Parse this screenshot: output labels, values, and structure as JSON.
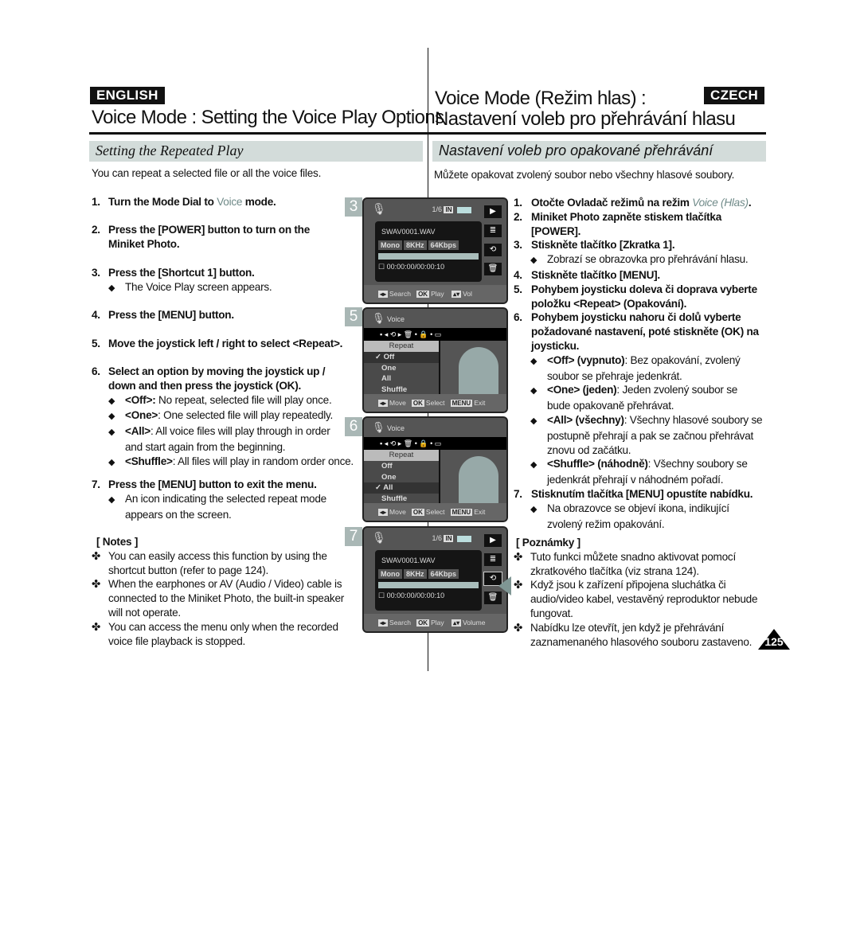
{
  "header": {
    "english_badge": "ENGLISH",
    "czech_badge": "CZECH",
    "title_en": "Voice Mode : Setting the Voice Play Options",
    "title_cz_1": "Voice Mode (Režim hlas) :",
    "title_cz_2": "Nastavení voleb pro přehrávání hlasu"
  },
  "section": {
    "en": "Setting the Repeated Play",
    "cz": "Nastavení voleb pro opakované přehrávání"
  },
  "intro": {
    "en": "You can repeat a selected file or all the voice files.",
    "cz": "Můžete opakovat zvolený soubor nebo všechny hlasové soubory."
  },
  "en_steps": [
    {
      "n": "1.",
      "pre": "Turn the Mode Dial to ",
      "voice": "Voice",
      "post": " mode."
    },
    {
      "n": "2.",
      "text": "Press the [POWER] button to turn on the Miniket Photo."
    },
    {
      "n": "3.",
      "text": "Press the [Shortcut 1] button.",
      "bullet": "The Voice Play screen appears."
    },
    {
      "n": "4.",
      "text": "Press the [MENU] button."
    },
    {
      "n": "5.",
      "text": "Move the joystick left / right to select <Repeat>."
    },
    {
      "n": "6.",
      "text": "Select an option by moving the joystick up / down and then press the joystick (OK).",
      "bullets": [
        {
          "k": "<Off>:",
          "v": " No repeat, selected file will play once."
        },
        {
          "k": "<One>",
          "v": ": One selected file will play repeatedly."
        },
        {
          "k": "<All>",
          "v": ": All voice files will play through in order and start again from the beginning."
        },
        {
          "k": "<Shuffle>",
          "v": ": All files will play in random order once."
        }
      ]
    },
    {
      "n": "7.",
      "text": "Press the [MENU] button to exit the menu.",
      "bullet": "An icon indicating the selected repeat mode appears on the screen."
    }
  ],
  "en_notes": {
    "title": "[ Notes ]",
    "items": [
      "You can easily access this function by using the shortcut button (refer to page 124).",
      "When the earphones or AV (Audio / Video) cable is connected to the Miniket Photo, the built-in speaker will not operate.",
      "You can access the menu only when the recorded voice file playback is stopped."
    ]
  },
  "cz_steps": [
    {
      "n": "1.",
      "pre": "Otočte Ovladač režimů na režim ",
      "voice": "Voice (Hlas)",
      "post": "."
    },
    {
      "n": "2.",
      "text": "Miniket Photo zapněte stiskem tlačítka [POWER]."
    },
    {
      "n": "3.",
      "text": "Stiskněte tlačítko [Zkratka 1].",
      "bullet": "Zobrazí se obrazovka pro přehrávání hlasu."
    },
    {
      "n": "4.",
      "text": "Stiskněte tlačítko [MENU]."
    },
    {
      "n": "5.",
      "text": "Pohybem joysticku doleva či doprava vyberte položku <Repeat> (Opakování)."
    },
    {
      "n": "6.",
      "text": "Pohybem joysticku nahoru či dolů vyberte požadované nastavení, poté stiskněte (OK) na joysticku.",
      "bullets": [
        {
          "k": "<Off> (vypnuto)",
          "v": ": Bez opakování, zvolený soubor se přehraje jedenkrát."
        },
        {
          "k": "<One> (jeden)",
          "v": ": Jeden zvolený soubor se bude opakovaně přehrávat."
        },
        {
          "k": "<All> (všechny)",
          "v": ": Všechny hlasové soubory se postupně přehrají a pak se začnou přehrávat znovu od začátku."
        },
        {
          "k": "<Shuffle> (náhodně)",
          "v": ": Všechny soubory se jedenkrát přehrají v náhodném pořadí."
        }
      ]
    },
    {
      "n": "7.",
      "text": "Stisknutím tlačítka [MENU] opustíte nabídku.",
      "bullet": "Na obrazovce se objeví ikona, indikující zvolený režim opakování."
    }
  ],
  "cz_notes": {
    "title": "[ Poznámky ]",
    "items": [
      "Tuto funkci můžete snadno aktivovat pomocí zkratkového tlačítka (viz strana 124).",
      "Když jsou k  zařízení připojena sluchátka či audio/video kabel, vestavěný reproduktor nebude fungovat.",
      "Nabídku lze otevřít, jen když je přehrávání zaznamenaného hlasového souboru zastaveno."
    ]
  },
  "screens": {
    "s3": {
      "num": "3",
      "counter": "1/6",
      "mem": "IN",
      "file": "SWAV0001.WAV",
      "info": [
        "Mono",
        "8KHz",
        "64Kbps"
      ],
      "time": "00:00:00/00:00:10",
      "hints": [
        {
          "k": "◂▸",
          "t": "Search"
        },
        {
          "k": "OK",
          "t": "Play"
        },
        {
          "k": "▴▾",
          "t": "Vol"
        }
      ]
    },
    "s5": {
      "num": "5",
      "title": "Voice",
      "menu_title": "Repeat",
      "options": [
        "Off",
        "One",
        "All",
        "Shuffle"
      ],
      "selected": "Off",
      "hints": [
        {
          "k": "◂▸",
          "t": "Move"
        },
        {
          "k": "OK",
          "t": "Select"
        },
        {
          "k": "MENU",
          "t": "Exit"
        }
      ]
    },
    "s6": {
      "num": "6",
      "title": "Voice",
      "menu_title": "Repeat",
      "options": [
        "Off",
        "One",
        "All",
        "Shuffle"
      ],
      "selected": "All",
      "hints": [
        {
          "k": "◂▸",
          "t": "Move"
        },
        {
          "k": "OK",
          "t": "Select"
        },
        {
          "k": "MENU",
          "t": "Exit"
        }
      ]
    },
    "s7": {
      "num": "7",
      "counter": "1/6",
      "mem": "IN",
      "file": "SWAV0001.WAV",
      "info": [
        "Mono",
        "8KHz",
        "64Kbps"
      ],
      "time": "00:00:00/00:00:10",
      "hints": [
        {
          "k": "◂▸",
          "t": "Search"
        },
        {
          "k": "OK",
          "t": "Play"
        },
        {
          "k": "▴▾",
          "t": "Volume"
        }
      ]
    }
  },
  "page_number": "125",
  "colors": {
    "section_bg": "#d3dcda",
    "accent": "#6f8a88",
    "screen_bg": "#555555"
  }
}
